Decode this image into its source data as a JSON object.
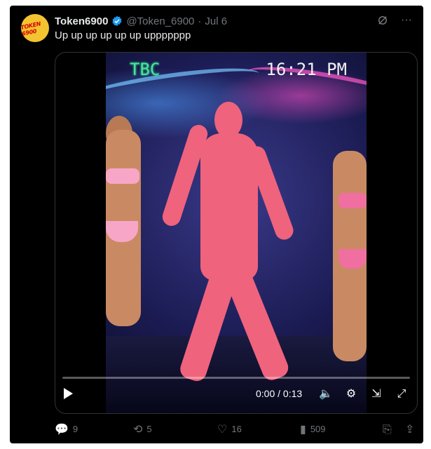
{
  "tweet": {
    "avatar_text": "TOKEN 6900",
    "display_name": "Token6900",
    "handle": "@Token_6900",
    "separator": "·",
    "date": "Jul 6",
    "text": "Up up up up up up uppppppp",
    "verified_color": "#1d9bf0"
  },
  "media": {
    "overlay_channel": "TBC",
    "overlay_clock": "16:21 PM",
    "progress_fraction": 0.0
  },
  "player": {
    "time": "0:00 / 0:13",
    "icons": [
      "play-icon",
      "volume-icon",
      "settings-icon",
      "pip-icon",
      "fullscreen-icon"
    ]
  },
  "actions": {
    "replies": "9",
    "reposts": "5",
    "likes": "16",
    "views": "509"
  },
  "colors": {
    "background": "#000000",
    "text": "#e7e9ea",
    "muted": "#71767b"
  }
}
